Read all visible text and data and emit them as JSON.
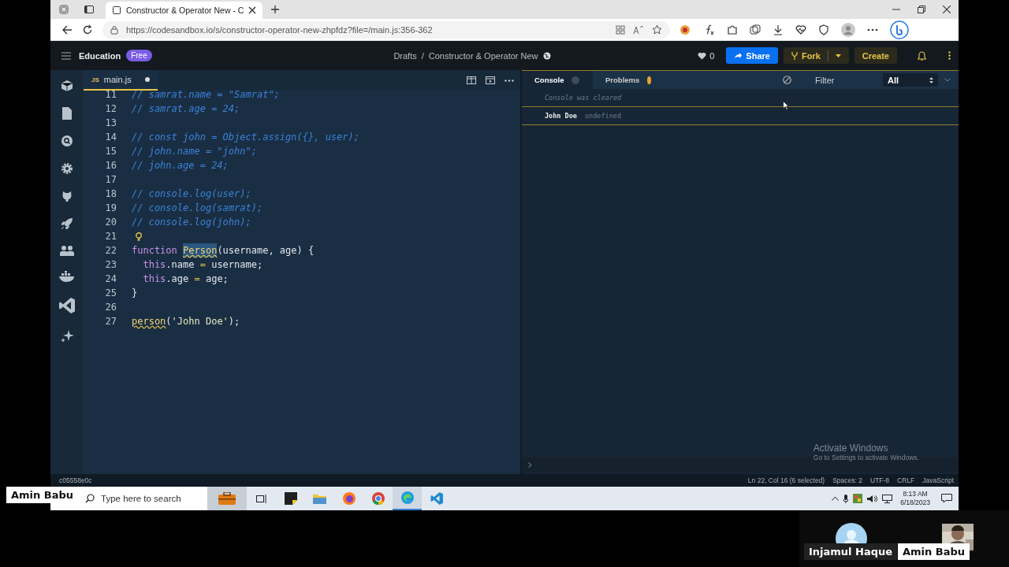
{
  "call": {
    "presenter_label": "Amin Babu",
    "participants": [
      {
        "name": "Injamul Haque",
        "kind": "avatar"
      },
      {
        "name": "Amin Babu",
        "kind": "camera"
      }
    ]
  },
  "browser": {
    "tab_title": "Constructor & Operator New - C",
    "address": "https://codesandbox.io/s/constructor-operator-new-zhpfdz?file=/main.js:356-362"
  },
  "header": {
    "workspace": "Education",
    "plan": "Free",
    "breadcrumb": [
      "Drafts",
      "Constructor & Operator New"
    ],
    "breadcrumb_separator": "/",
    "likes": "0",
    "buttons": [
      {
        "label": "Share",
        "kind": "share"
      },
      {
        "label": "Fork",
        "kind": "fork"
      },
      {
        "label": "Create",
        "kind": "create"
      }
    ]
  },
  "editor": {
    "tabs": [
      {
        "label": "main.js",
        "file_type": "JS",
        "modified": true,
        "selected": true
      }
    ],
    "lines": [
      {
        "number": "11",
        "kind": "code",
        "tokens": [
          {
            "text": "// samrat.name = \"Samrat\";",
            "kind": "comment"
          }
        ]
      },
      {
        "number": "12",
        "kind": "code",
        "tokens": [
          {
            "text": "// samrat.age = 24;",
            "kind": "comment"
          }
        ]
      },
      {
        "number": "13",
        "kind": "code"
      },
      {
        "number": "14",
        "kind": "code",
        "tokens": [
          {
            "text": "// const john = Object.assign({}, user);",
            "kind": "comment"
          }
        ]
      },
      {
        "number": "15",
        "kind": "code",
        "tokens": [
          {
            "text": "// john.name = \"john\";",
            "kind": "comment"
          }
        ]
      },
      {
        "number": "16",
        "kind": "code",
        "tokens": [
          {
            "text": "// john.age = 24;",
            "kind": "comment"
          }
        ]
      },
      {
        "number": "17",
        "kind": "code"
      },
      {
        "number": "18",
        "kind": "code",
        "tokens": [
          {
            "text": "// console.log(user);",
            "kind": "comment"
          }
        ]
      },
      {
        "number": "19",
        "kind": "code",
        "tokens": [
          {
            "text": "// console.log(samrat);",
            "kind": "comment"
          }
        ]
      },
      {
        "number": "20",
        "kind": "code",
        "tokens": [
          {
            "text": "// console.log(john);",
            "kind": "comment"
          }
        ]
      },
      {
        "number": "21",
        "kind": "hint"
      },
      {
        "number": "22",
        "kind": "code",
        "tokens": [
          {
            "text": "function",
            "kind": "keyword"
          },
          {
            "text": "Person",
            "kind": "selection"
          },
          {
            "text": "(username, age) {",
            "kind": "plain"
          }
        ]
      },
      {
        "number": "23",
        "kind": "indented",
        "tokens": [
          {
            "text": "this",
            "kind": "keyword"
          },
          {
            "text": ".name ",
            "kind": "plain"
          },
          {
            "text": "=",
            "kind": "operator"
          },
          {
            "text": " username;",
            "kind": "plain"
          }
        ]
      },
      {
        "number": "24",
        "kind": "indented",
        "tokens": [
          {
            "text": "this",
            "kind": "keyword"
          },
          {
            "text": ".age ",
            "kind": "plain"
          },
          {
            "text": "=",
            "kind": "operator"
          },
          {
            "text": " age;",
            "kind": "plain"
          }
        ]
      },
      {
        "number": "25",
        "kind": "code",
        "tokens": [
          {
            "text": "}",
            "kind": "plain"
          }
        ]
      },
      {
        "number": "26",
        "kind": "code"
      },
      {
        "number": "27",
        "kind": "code",
        "tokens": [
          {
            "text": "person",
            "kind": "warning"
          },
          {
            "text": "(",
            "kind": "plain"
          },
          {
            "text": "'John Doe'",
            "kind": "string"
          },
          {
            "text": ");",
            "kind": "plain"
          }
        ]
      }
    ]
  },
  "console": {
    "tabs": [
      {
        "label": "Console",
        "selected": true
      },
      {
        "label": "Problems",
        "selected": false
      }
    ],
    "filter_placeholder": "Filter",
    "level": "All",
    "entries": [
      {
        "kind": "info",
        "text": "Console was cleared"
      },
      {
        "kind": "log",
        "text": "John Doe",
        "result": "undefined"
      }
    ]
  },
  "watermark": {
    "title": "Activate Windows",
    "subtitle": "Go to Settings to activate Windows."
  },
  "status_bar": {
    "commit": "c05558e0c",
    "items": [
      "Ln 22, Col 16 (6 selected)",
      "Spaces: 2",
      "UTF-8",
      "CRLF",
      "JavaScript"
    ]
  },
  "taskbar": {
    "search_placeholder": "Type here to search",
    "time": "8:13 AM",
    "date": "6/18/2023"
  }
}
